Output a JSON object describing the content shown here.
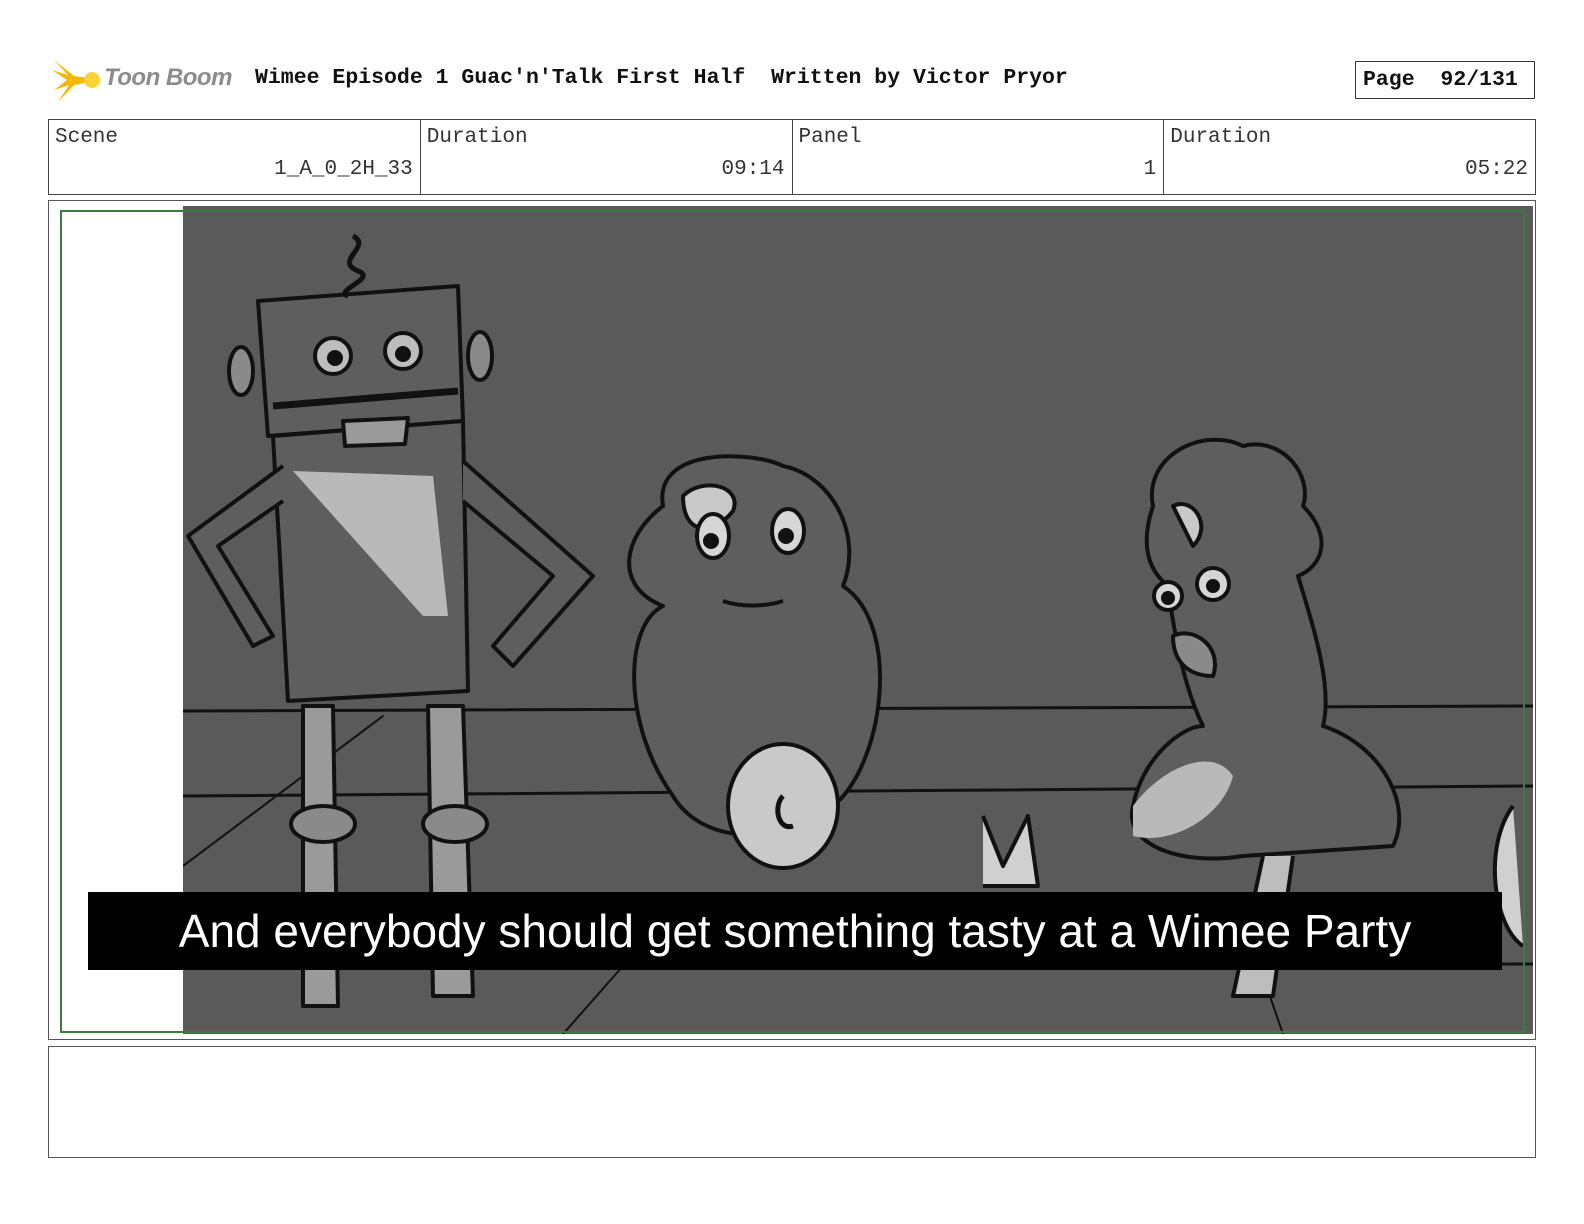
{
  "header": {
    "logo_text": "Toon Boom",
    "title": "Wimee Episode 1 Guac'n'Talk First Half  Written by Victor Pryor",
    "page_label": "Page",
    "page_value": "92/131"
  },
  "info": {
    "scene_label": "Scene",
    "scene_value": "1_A_0_2H_33",
    "scene_duration_label": "Duration",
    "scene_duration_value": "09:14",
    "panel_label": "Panel",
    "panel_value": "1",
    "panel_duration_label": "Duration",
    "panel_duration_value": "05:22"
  },
  "panel": {
    "caption": "And everybody should get something tasty at a Wimee Party"
  },
  "colors": {
    "safe_frame": "#3d7a3d",
    "drawing_bg": "#5a5a5a",
    "logo_star": "#f5b800"
  }
}
